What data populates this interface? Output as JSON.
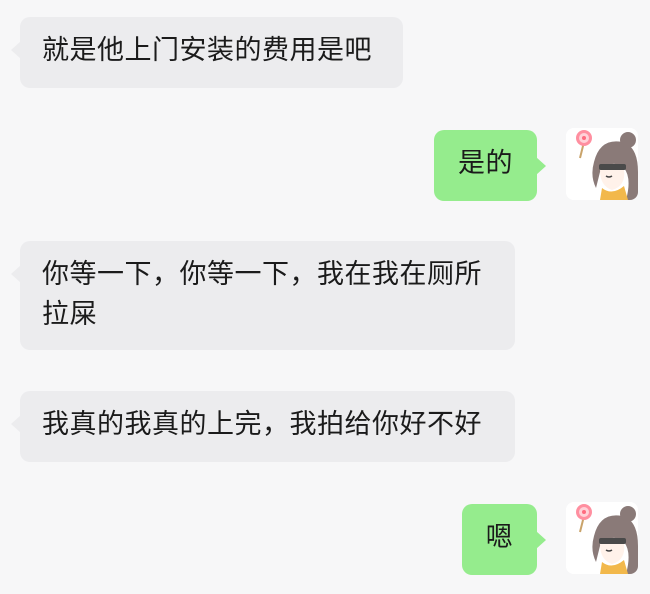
{
  "messages": [
    {
      "side": "left",
      "text": "就是他上门安装的费用是吧"
    },
    {
      "side": "right",
      "text": "是的"
    },
    {
      "side": "left",
      "text": "你等一下，你等一下，我在我在厕所拉屎"
    },
    {
      "side": "left",
      "text": "我真的我真的上完，我拍给你好不好"
    },
    {
      "side": "right",
      "text": "嗯"
    }
  ],
  "colors": {
    "background": "#f7f7f8",
    "incoming_bubble": "#ececee",
    "outgoing_bubble": "#95ec8d",
    "text": "#1b1b1b"
  },
  "avatar_icon": "anime-girl-lollipop-avatar"
}
